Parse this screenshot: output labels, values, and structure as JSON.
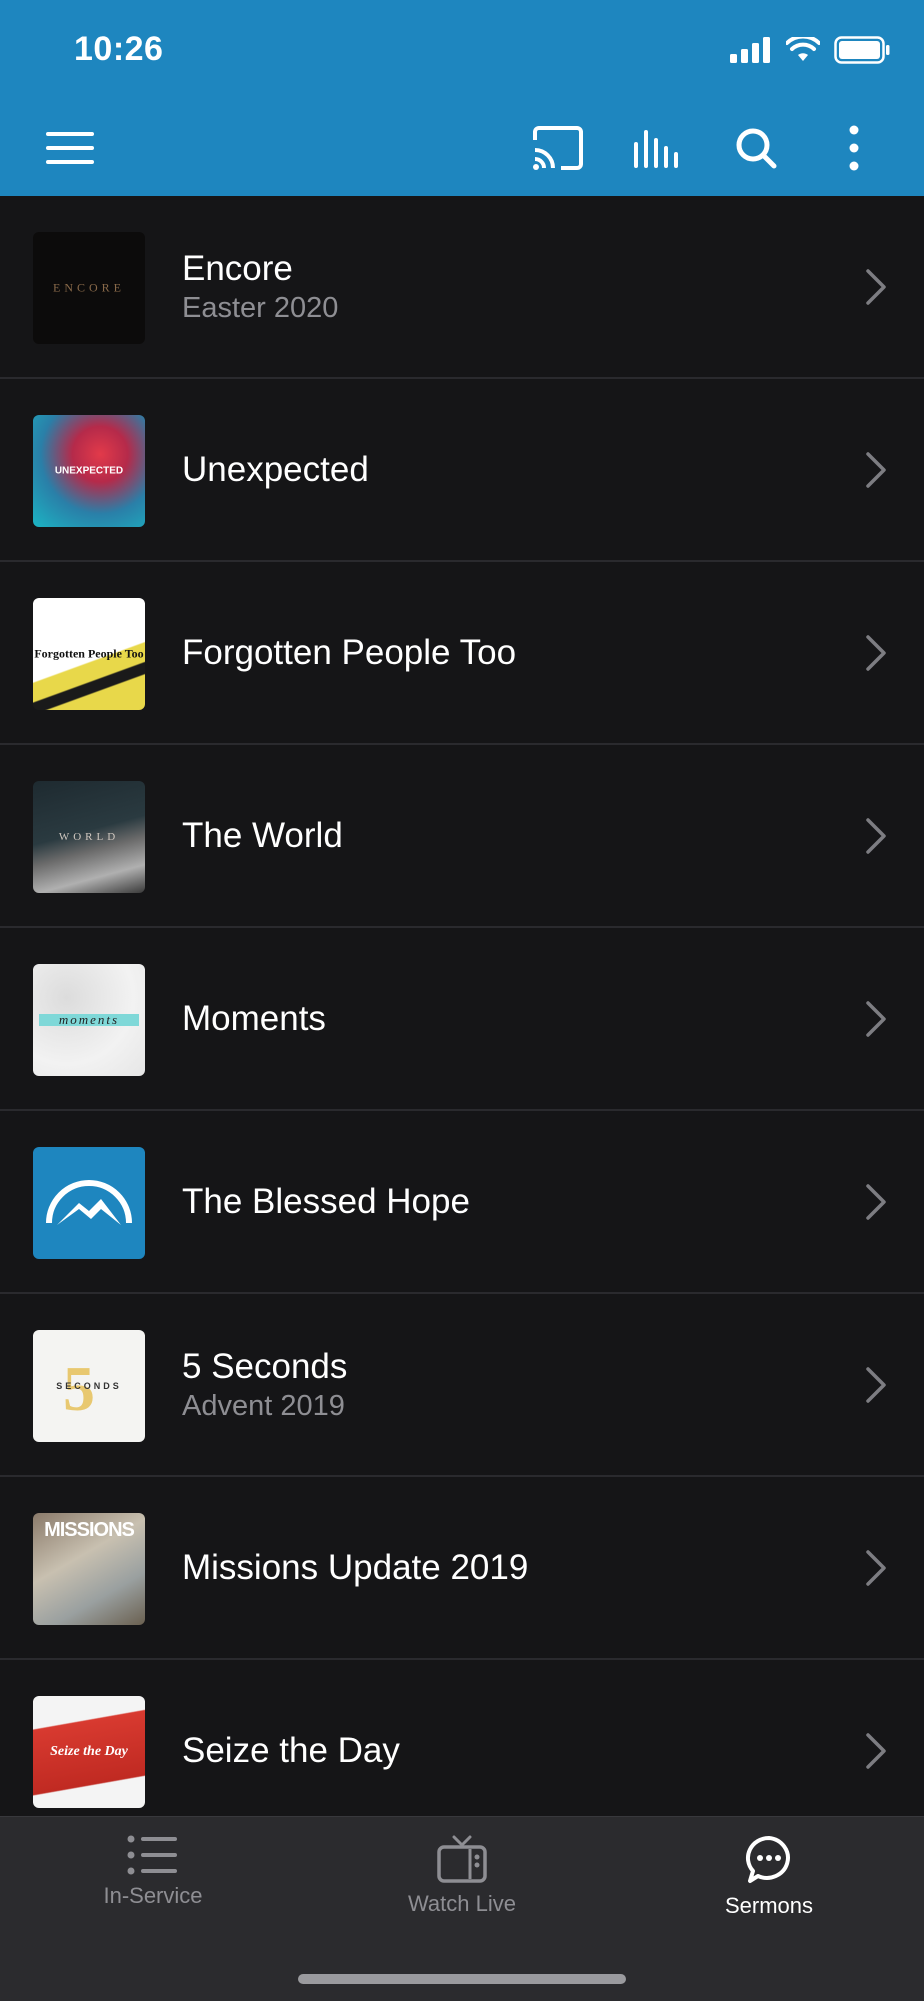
{
  "status": {
    "time": "10:26"
  },
  "colors": {
    "header": "#1e86bf",
    "background": "#151517",
    "tabbar": "#2b2b2e",
    "subtitle": "#8e8e93"
  },
  "toolbar": {
    "menu_icon": "hamburger-icon",
    "cast_icon": "cast-icon",
    "audio_icon": "equalizer-icon",
    "search_icon": "search-icon",
    "more_icon": "more-vertical-icon"
  },
  "sermons": [
    {
      "title": "Encore",
      "subtitle": "Easter 2020",
      "thumb_text": "ENCORE"
    },
    {
      "title": "Unexpected",
      "subtitle": "",
      "thumb_text": "UNEXPECTED"
    },
    {
      "title": "Forgotten People Too",
      "subtitle": "",
      "thumb_text": "Forgotten People Too"
    },
    {
      "title": "The World",
      "subtitle": "",
      "thumb_text": "WORLD"
    },
    {
      "title": "Moments",
      "subtitle": "",
      "thumb_text": "moments"
    },
    {
      "title": "The Blessed Hope",
      "subtitle": "",
      "thumb_text": ""
    },
    {
      "title": "5 Seconds",
      "subtitle": "Advent 2019",
      "thumb_text": "SECONDS"
    },
    {
      "title": "Missions Update 2019",
      "subtitle": "",
      "thumb_text": "MISSIONS"
    },
    {
      "title": "Seize the Day",
      "subtitle": "",
      "thumb_text": "Seize the Day"
    }
  ],
  "tabs": [
    {
      "label": "In-Service",
      "icon": "list-icon",
      "active": false
    },
    {
      "label": "Watch Live",
      "icon": "tv-icon",
      "active": false
    },
    {
      "label": "Sermons",
      "icon": "chat-bubble-icon",
      "active": true
    }
  ]
}
